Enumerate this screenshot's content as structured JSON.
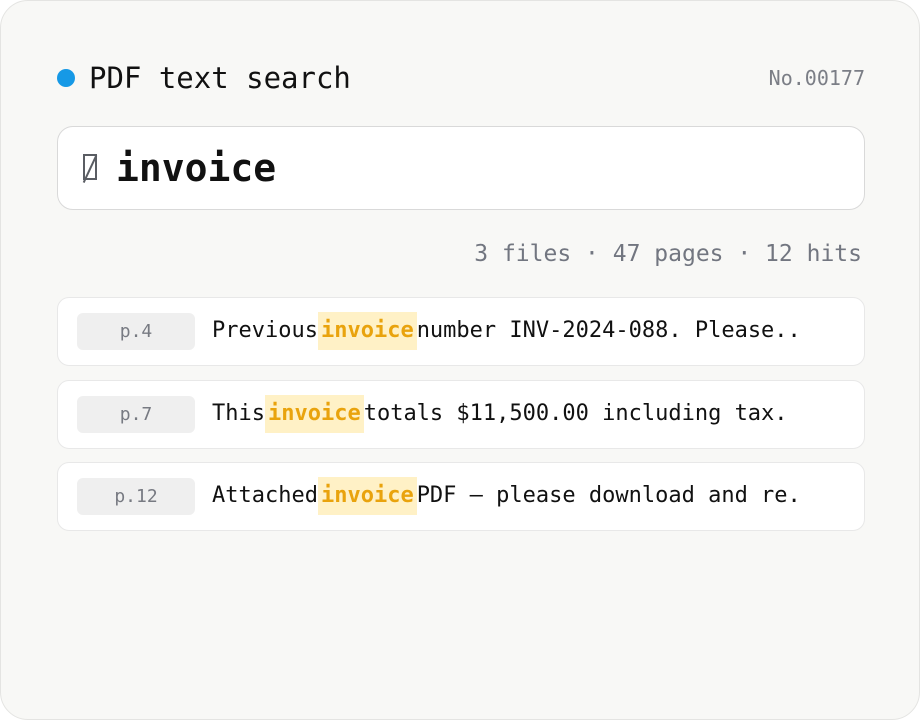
{
  "header": {
    "title": "PDF text search",
    "doc_number": "No.00177",
    "status_color": "#1699e6"
  },
  "search": {
    "query": "invoice",
    "icon": "search-icon"
  },
  "summary": "3 files · 47 pages · 12 hits",
  "results": [
    {
      "page": "p.4",
      "before": "Previous",
      "match": "invoice",
      "after": "number INV-2024-088. Please.."
    },
    {
      "page": "p.7",
      "before": "This",
      "match": "invoice",
      "after": "totals $11,500.00 including tax."
    },
    {
      "page": "p.12",
      "before": "Attached",
      "match": "invoice",
      "after": "PDF — please download and re."
    }
  ],
  "colors": {
    "highlight_text": "#e9a30d",
    "highlight_bg": "#fff1c6",
    "accent": "#1699e6"
  }
}
